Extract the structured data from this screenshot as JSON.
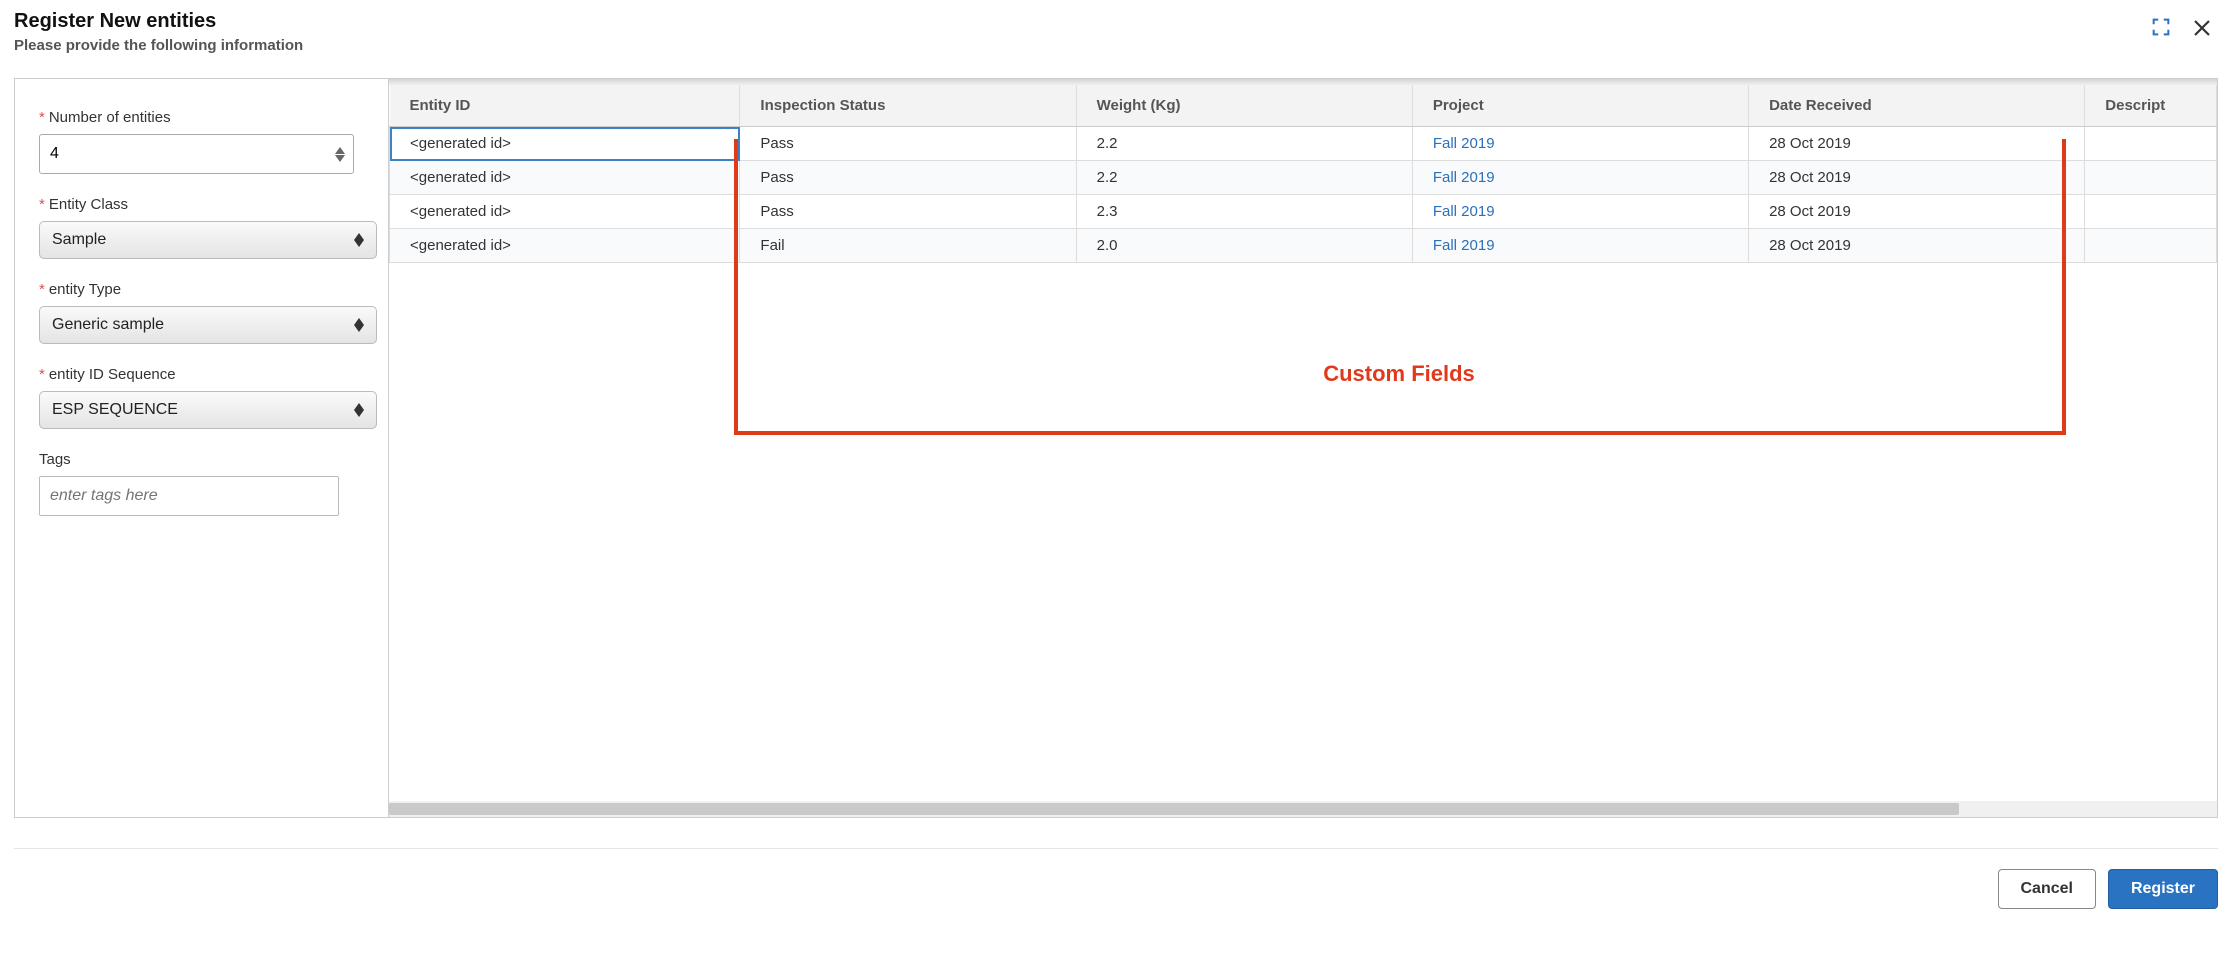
{
  "header": {
    "title": "Register New entities",
    "subtitle": "Please provide the following information"
  },
  "sidebar": {
    "numberOfEntities": {
      "label": "Number of entities",
      "value": "4"
    },
    "entityClass": {
      "label": "Entity Class",
      "value": "Sample"
    },
    "entityType": {
      "label": "entity Type",
      "value": "Generic sample"
    },
    "entityIdSequence": {
      "label": "entity ID Sequence",
      "value": "ESP SEQUENCE"
    },
    "tags": {
      "label": "Tags",
      "placeholder": "enter tags here"
    }
  },
  "table": {
    "columns": [
      "Entity ID",
      "Inspection Status",
      "Weight (Kg)",
      "Project",
      "Date Received",
      "Descript"
    ],
    "rows": [
      {
        "entityId": "<generated id>",
        "inspectionStatus": "Pass",
        "weight": "2.2",
        "project": "Fall 2019",
        "dateReceived": "28 Oct 2019",
        "description": ""
      },
      {
        "entityId": "<generated id>",
        "inspectionStatus": "Pass",
        "weight": "2.2",
        "project": "Fall 2019",
        "dateReceived": "28 Oct 2019",
        "description": ""
      },
      {
        "entityId": "<generated id>",
        "inspectionStatus": "Pass",
        "weight": "2.3",
        "project": "Fall 2019",
        "dateReceived": "28 Oct 2019",
        "description": ""
      },
      {
        "entityId": "<generated id>",
        "inspectionStatus": "Fail",
        "weight": "2.0",
        "project": "Fall 2019",
        "dateReceived": "28 Oct 2019",
        "description": ""
      }
    ]
  },
  "annotation": {
    "label": "Custom Fields"
  },
  "footer": {
    "cancel": "Cancel",
    "register": "Register"
  }
}
